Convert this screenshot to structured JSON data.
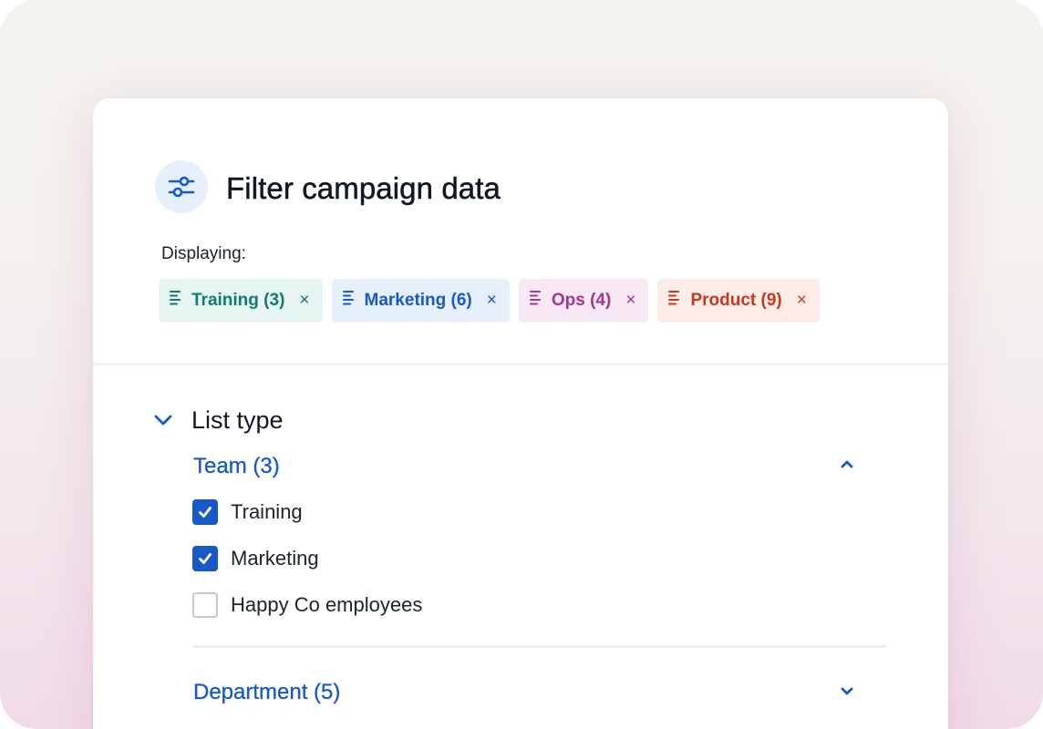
{
  "panel": {
    "title": "Filter campaign data",
    "displaying_label": "Displaying:"
  },
  "chips": [
    {
      "label": "Training (3)",
      "remove": "×",
      "color": "#137a6e",
      "bg": "#e6f5f2"
    },
    {
      "label": "Marketing (6)",
      "remove": "×",
      "color": "#1659c7",
      "bg": "#e6f0fb"
    },
    {
      "label": "Ops (4)",
      "remove": "×",
      "color": "#a2358d",
      "bg": "#f8e8f4"
    },
    {
      "label": "Product (9)",
      "remove": "×",
      "color": "#c43a1f",
      "bg": "#fdece8"
    }
  ],
  "list_type": {
    "title": "List type",
    "expanded": true,
    "groups": [
      {
        "title": "Team (3)",
        "expanded": true,
        "options": [
          {
            "label": "Training",
            "checked": true
          },
          {
            "label": "Marketing",
            "checked": true
          },
          {
            "label": "Happy Co employees",
            "checked": false
          }
        ]
      },
      {
        "title": "Department (5)",
        "expanded": false
      }
    ]
  },
  "colors": {
    "accent": "#1659c7",
    "text": "#101828"
  }
}
